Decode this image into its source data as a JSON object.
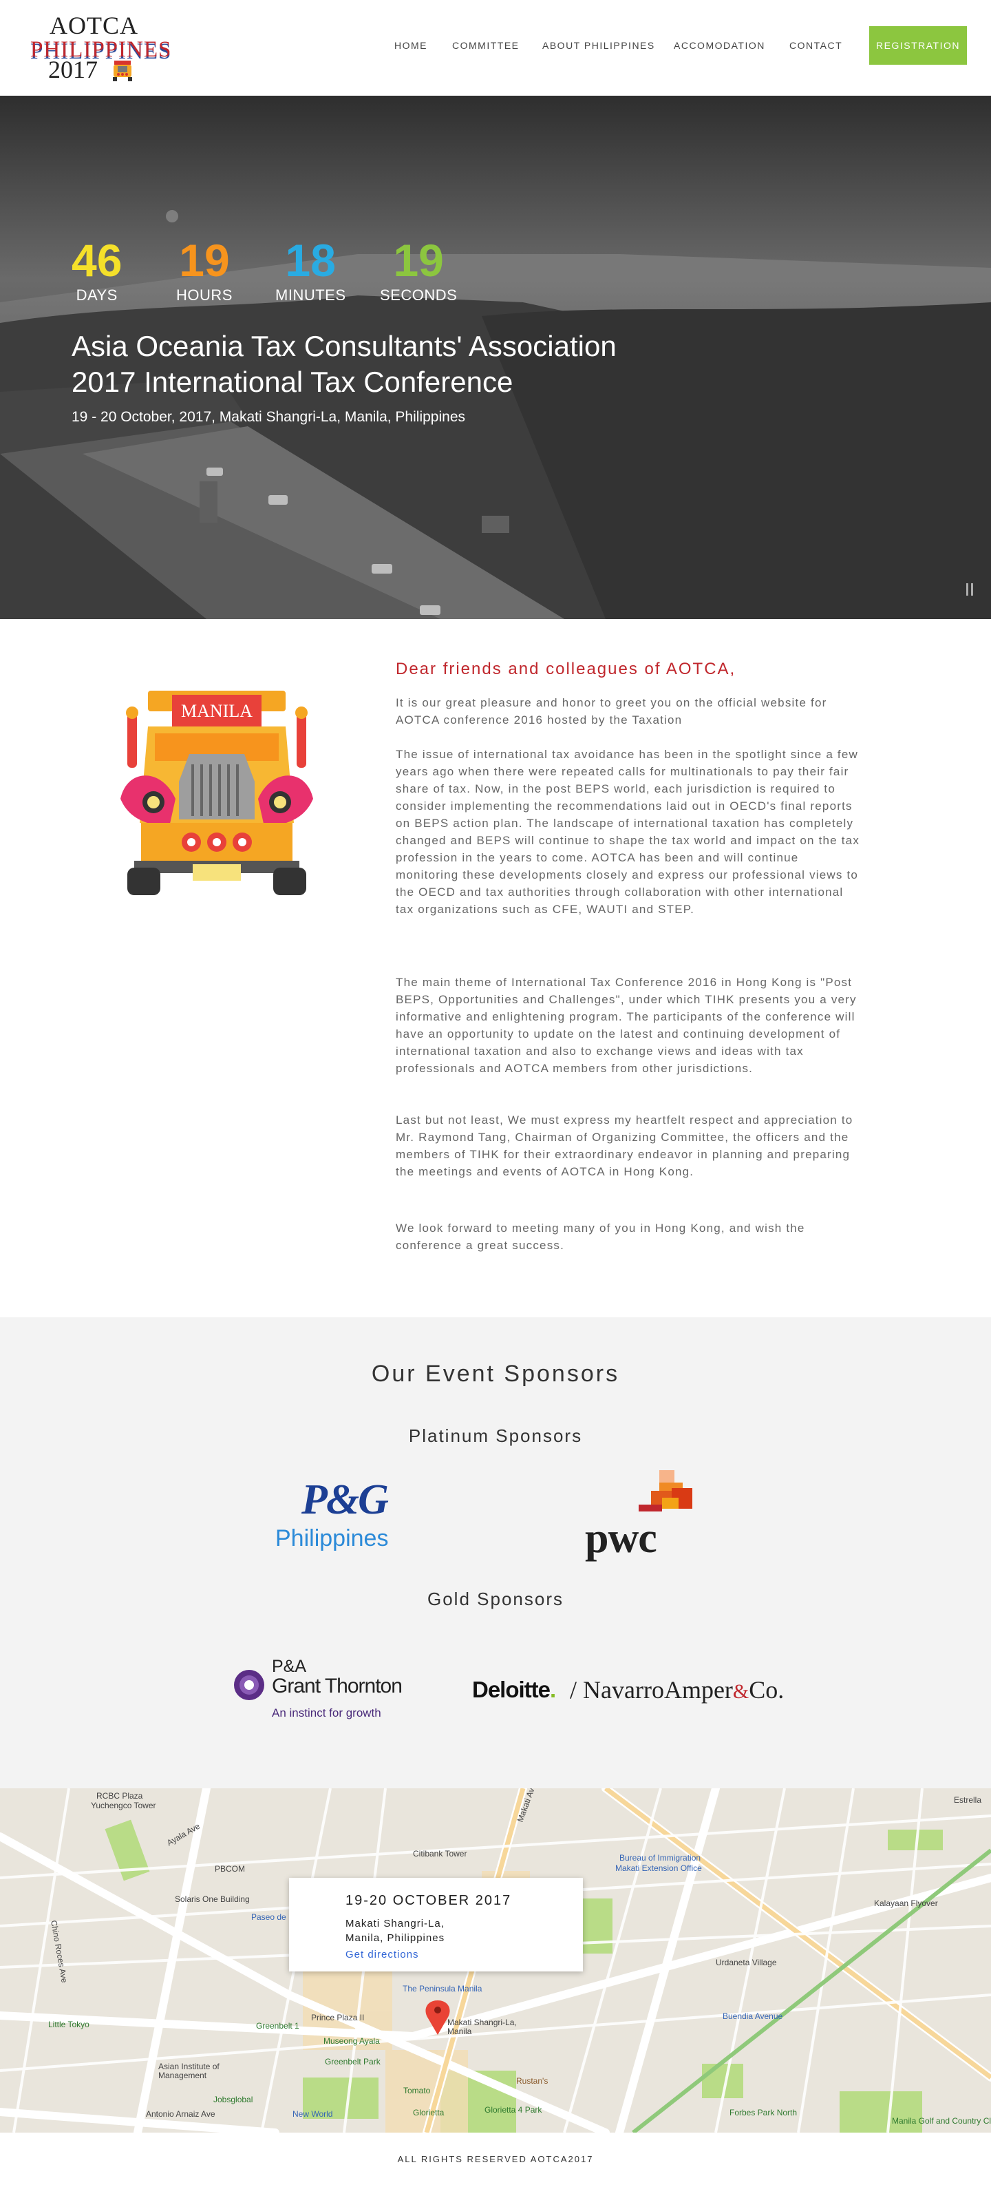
{
  "logo": {
    "line1": "AOTCA",
    "line2": "PHILIPPINES",
    "line3": "2017"
  },
  "nav": {
    "items": [
      "HOME",
      "COMMITTEE",
      "ABOUT PHILIPPINES",
      "ACCOMODATION",
      "CONTACT"
    ],
    "register": "REGISTRATION"
  },
  "hero": {
    "countdown": [
      {
        "value": "46",
        "label": "DAYS",
        "color": "#f5e02a"
      },
      {
        "value": "19",
        "label": "HOURS",
        "color": "#f7941d"
      },
      {
        "value": "18",
        "label": "MINUTES",
        "color": "#29abe2"
      },
      {
        "value": "19",
        "label": "SECONDS",
        "color": "#8cc63f"
      }
    ],
    "title_line1": "Asia Oceania Tax Consultants' Association",
    "title_line2": "2017 International Tax Conference",
    "subtitle": "19 - 20 October, 2017, Makati Shangri-La, Manila, Philippines"
  },
  "welcome": {
    "jeep_sign": "MANILA",
    "title": "Dear friends and colleagues of AOTCA,",
    "paragraphs": [
      "It is our great pleasure and honor to greet you on the official website for AOTCA conference 2016 hosted by the Taxation",
      "The issue of international tax avoidance has been in the spotlight since a few years ago when there were repeated calls for multinationals to pay their fair share of tax. Now, in the post BEPS world, each jurisdiction is required to consider implementing the recommendations laid out in OECD's final reports on BEPS action plan. The landscape of international taxation has completely changed and BEPS will continue to shape the tax world and impact on the tax profession in the years to come. AOTCA has been and will continue monitoring these developments closely and express our professional views to the OECD and tax authorities through collaboration with other international tax organizations such as CFE, WAUTI and STEP.",
      "The main theme of International Tax Conference 2016 in Hong Kong is \"Post BEPS, Opportunities and Challenges\", under which TIHK presents you a very informative and enlightening program. The participants of the conference will have an opportunity to update on the latest and continuing development of international taxation and also to exchange views and ideas with tax professionals and AOTCA members from other jurisdictions.",
      "Last but not least, We must express my heartfelt respect and appreciation to Mr. Raymond Tang, Chairman of Organizing Committee, the officers and the members of TIHK for their extraordinary endeavor in planning and preparing the meetings and events of AOTCA in Hong Kong.",
      "We look forward to meeting many of you in Hong Kong, and wish the conference a great success."
    ]
  },
  "sponsors": {
    "title": "Our Event Sponsors",
    "platinum_title": "Platinum Sponsors",
    "gold_title": "Gold Sponsors",
    "pg": {
      "mark": "P&G",
      "sub": "Philippines"
    },
    "pwc": "pwc",
    "gt": {
      "line1": "P&A",
      "line2": "Grant Thornton",
      "line3": "An instinct for growth"
    },
    "deloitte": {
      "name": "Deloitte",
      "dot": "."
    },
    "navarro": {
      "slash": "/",
      "name1": "NavarroAmper",
      "amp": "&",
      "name2": "Co."
    }
  },
  "map": {
    "date": "19-20 OCTOBER 2017",
    "address_line1": "Makati Shangri-La,",
    "address_line2": "Manila, Philippines",
    "directions": "Get directions",
    "labels": [
      "RCBC Plaza",
      "Yuchengco Tower",
      "Ayala Ave",
      "Citibank Tower",
      "Bureau of Immigration",
      "Makati Extension Office",
      "PBCOM",
      "Solaris One Building",
      "Paseo de Roxas",
      "Urdaneta Village",
      "Kalayaan Flyover",
      "Little Tokyo",
      "Greenbelt 1",
      "Prince Plaza II",
      "The Peninsula Manila",
      "Makati Shangri-La, Manila",
      "Buendia Avenue",
      "Museong Ayala",
      "Greenbelt Park",
      "Asian Institute of Management",
      "Tomato",
      "Rustan's",
      "Glorietta",
      "Glorietta 4 Park",
      "Jobsglobal",
      "New World",
      "Forbes Park North",
      "Manila Golf and Country Club",
      "Antonio Arnaiz Ave",
      "Makati Ave",
      "Estrella",
      "Chino Roces Ave"
    ]
  },
  "footer": "ALL RIGHTS RESERVED AOTCA2017"
}
